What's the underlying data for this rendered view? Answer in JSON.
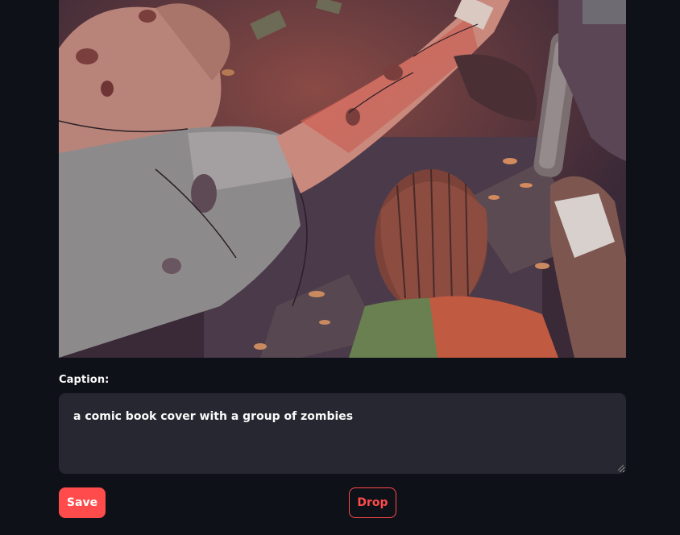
{
  "image": {
    "alt": "comic book cover illustration"
  },
  "caption": {
    "label": "Caption:",
    "value": "a comic book cover with a group of zombies"
  },
  "actions": {
    "save_label": "Save",
    "drop_label": "Drop"
  },
  "colors": {
    "background": "#0e1117",
    "input_background": "#262730",
    "accent": "#ff4b4b",
    "text": "#fafafa"
  }
}
